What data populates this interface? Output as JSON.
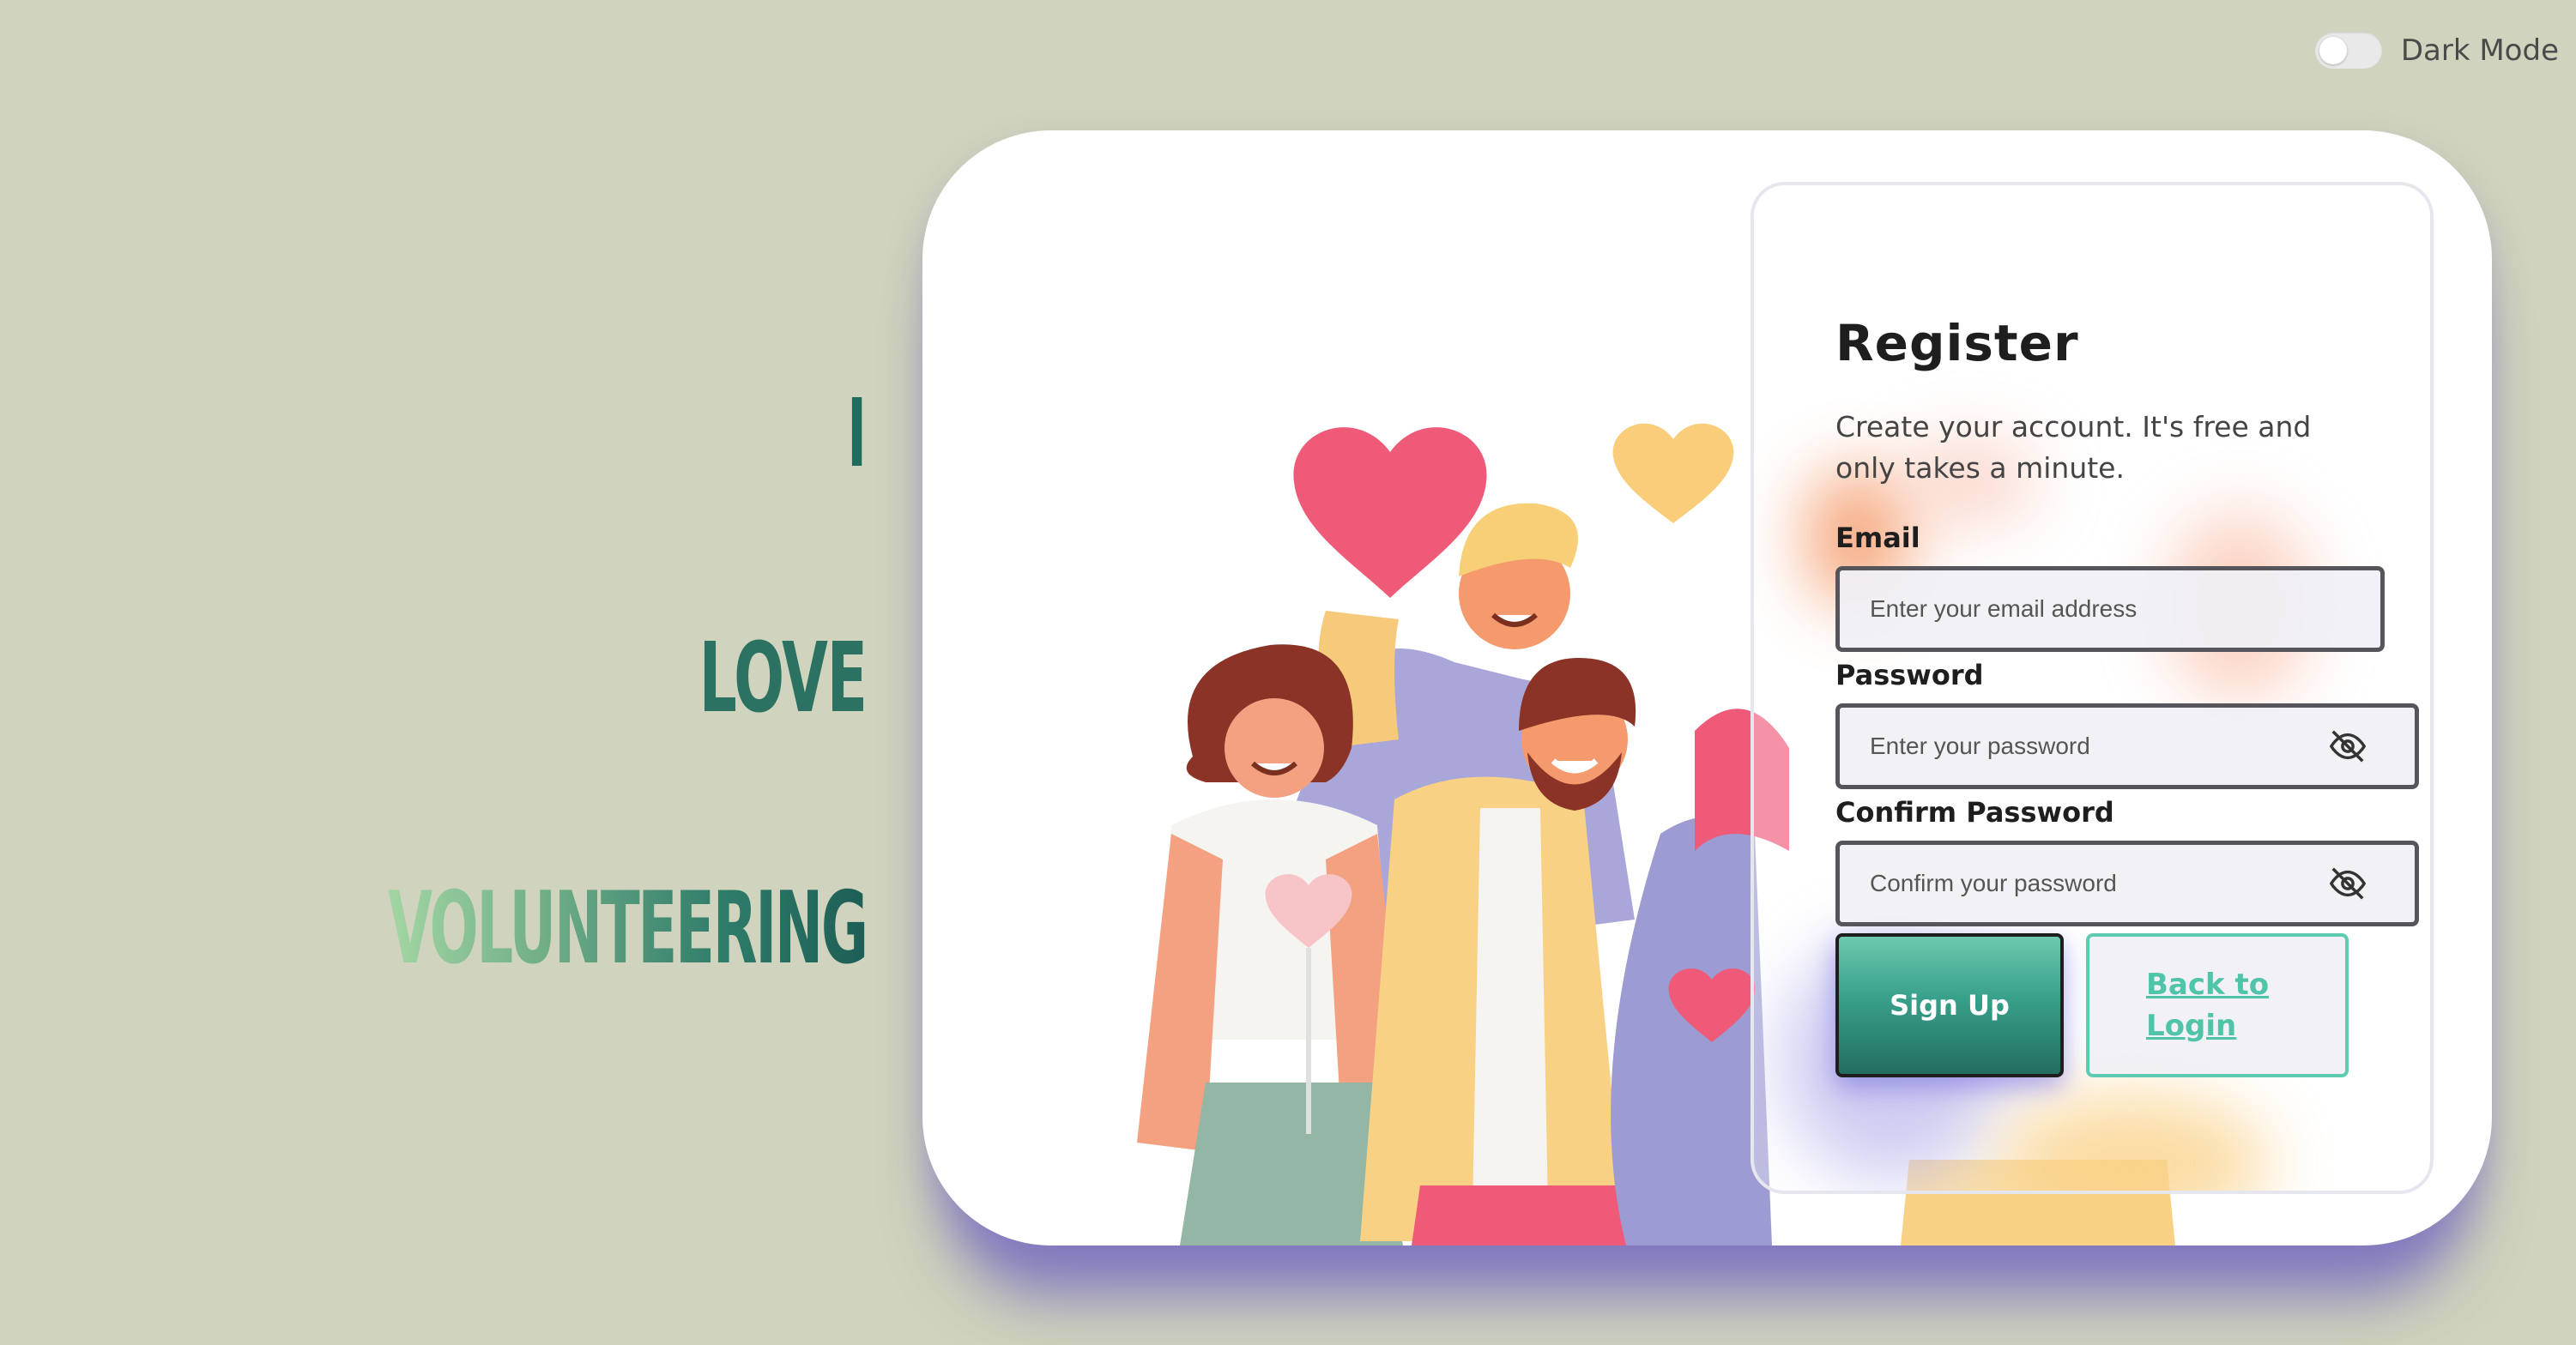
{
  "dark_mode": {
    "label": "Dark Mode",
    "enabled": false
  },
  "slogan": {
    "line1": "I",
    "line2": "LOVE",
    "line3": "VOLUNTEERING"
  },
  "register": {
    "title": "Register",
    "subtitle": "Create your account. It's free and only takes a minute.",
    "email": {
      "label": "Email",
      "placeholder": "Enter your email address"
    },
    "password": {
      "label": "Password",
      "placeholder": "Enter your password"
    },
    "confirm_password": {
      "label": "Confirm Password",
      "placeholder": "Confirm your password"
    },
    "signup_label": "Sign Up",
    "back_label": "Back to Login"
  },
  "icons": {
    "password_visibility": "eye-slash-icon",
    "confirm_visibility": "eye-slash-icon"
  },
  "colors": {
    "background": "#d0d3bd",
    "accent": "#38a08a",
    "link": "#4fc4a9",
    "card_shadow": "#7870be"
  }
}
